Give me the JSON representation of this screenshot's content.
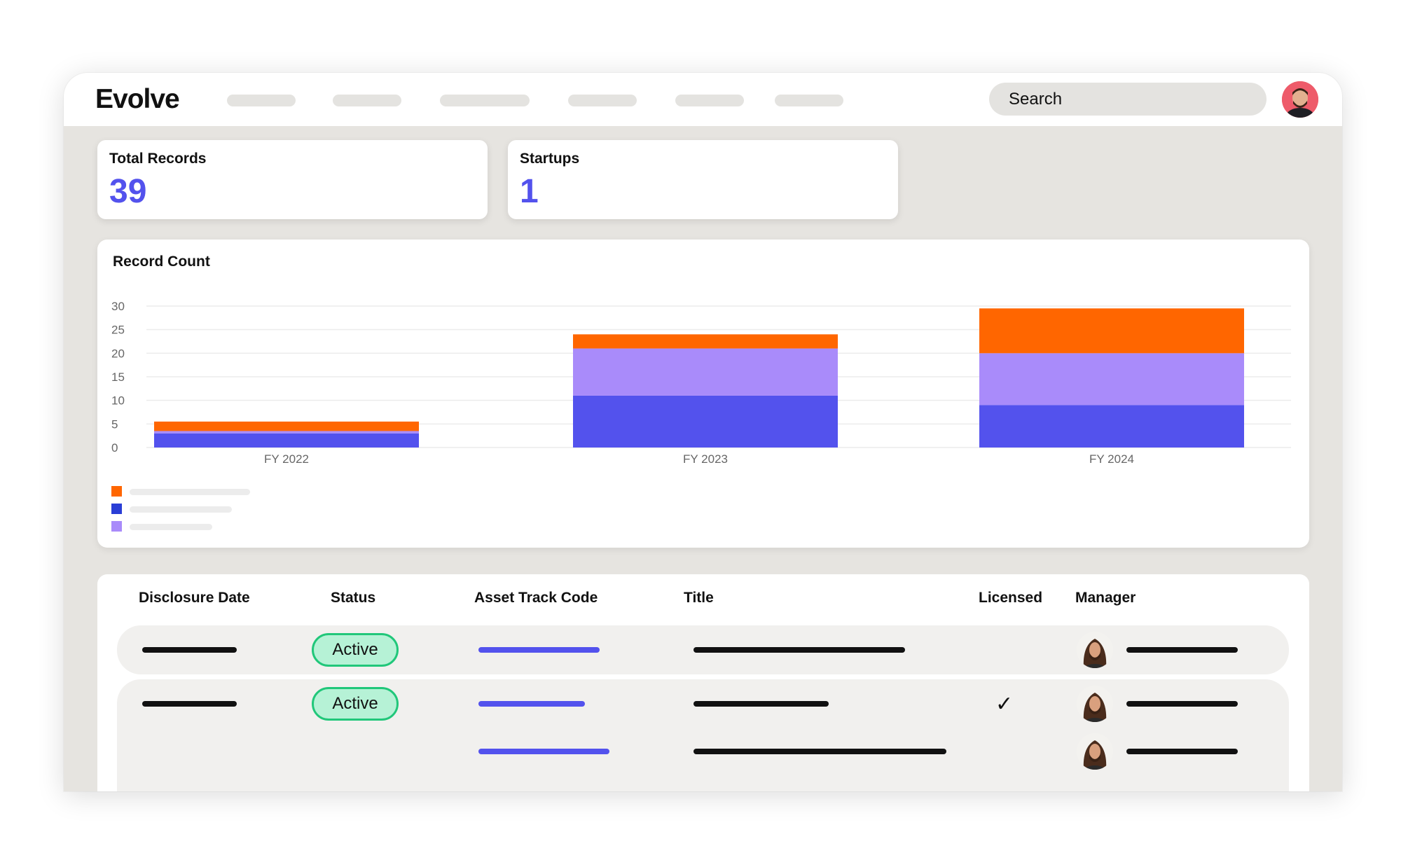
{
  "app": {
    "logo": "Evolve"
  },
  "search": {
    "label": "Search"
  },
  "stats": [
    {
      "label": "Total Records",
      "value": "39"
    },
    {
      "label": "Startups",
      "value": "1"
    }
  ],
  "colors": {
    "accent": "#5352ed",
    "orange": "#ff6600",
    "lavender": "#a98bfa",
    "blue": "#5352ed",
    "legend_blue": "#2a3ed6",
    "active_bg": "#b6f2d6",
    "active_border": "#21c77a"
  },
  "chart_data": {
    "type": "bar",
    "stacked": true,
    "title": "Record Count",
    "categories": [
      "FY 2022",
      "FY 2023",
      "FY 2024"
    ],
    "series": [
      {
        "values": [
          3,
          11,
          9
        ],
        "color": "#5352ed"
      },
      {
        "values": [
          0.5,
          10,
          11
        ],
        "color": "#a98bfa"
      },
      {
        "values": [
          2,
          3,
          9.5
        ],
        "color": "#ff6600"
      }
    ],
    "yticks": [
      0,
      5,
      10,
      15,
      20,
      25,
      30
    ],
    "ylim": [
      0,
      30
    ],
    "grid": true,
    "legend": "bottom-left"
  },
  "table": {
    "headers": [
      "Disclosure Date",
      "Status",
      "Asset Track Code",
      "Title",
      "Licensed",
      "Manager"
    ],
    "rows": [
      {
        "status": "Active",
        "licensed": ""
      },
      {
        "status": "Active",
        "licensed": "✓"
      }
    ]
  }
}
